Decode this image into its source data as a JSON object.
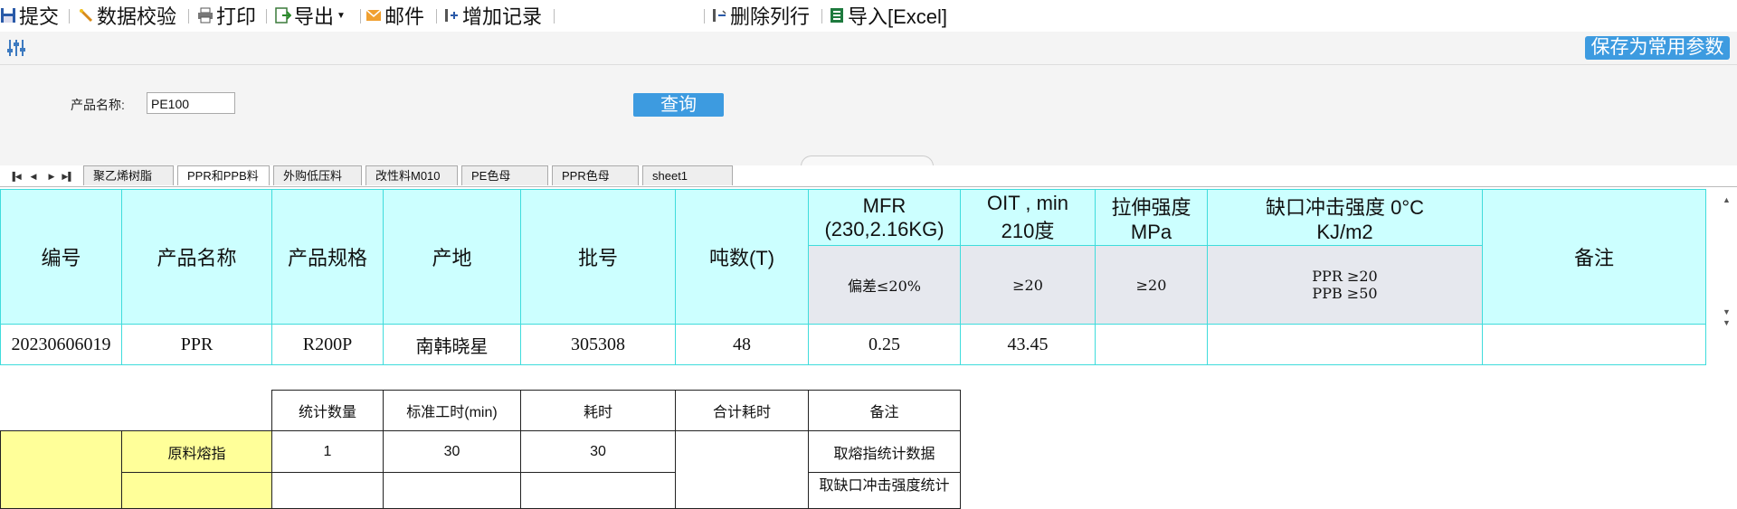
{
  "toolbar": {
    "submit": "提交",
    "validate": "数据校验",
    "print": "打印",
    "export": "导出",
    "mail": "邮件",
    "add_record": "增加记录",
    "delete_row": "删除列行",
    "import_excel": "导入[Excel]"
  },
  "params": {
    "save_btn": "保存为常用参数",
    "product_label": "产品名称:",
    "product_value": "PE100",
    "query_btn": "查询"
  },
  "tabs": [
    "聚乙烯树脂",
    "PPR和PPB料",
    "外购低压料",
    "改性料M010",
    "PE色母",
    "PPR色母",
    "sheet1"
  ],
  "main_table": {
    "headers": {
      "no": "编号",
      "product_name": "产品名称",
      "spec": "产品规格",
      "origin": "产地",
      "batch": "批号",
      "tonnage": "吨数(T)",
      "mfr_line1": "MFR",
      "mfr_line2": "(230,2.16KG)",
      "oit_line1": "OIT , min",
      "oit_line2": "210度",
      "tensile_line1": "拉伸强度",
      "tensile_line2": "MPa",
      "impact_line1": "缺口冲击强度 0°C",
      "impact_line2": "KJ/m2",
      "remark": "备注"
    },
    "sub_headers": {
      "mfr": "偏差≤20%",
      "oit": "≥20",
      "tensile": "≥20",
      "impact_line1": "PPR ≥20",
      "impact_line2": "PPB ≥50"
    },
    "row": {
      "no": "20230606019",
      "product_name": "PPR",
      "spec": "R200P",
      "origin": "南韩晓星",
      "batch": "305308",
      "tonnage": "48",
      "mfr": "0.25",
      "oit": "43.45",
      "tensile": "",
      "impact": "",
      "remark": ""
    }
  },
  "lower_table": {
    "headers": {
      "count": "统计数量",
      "std_time": "标准工时(min)",
      "time_cost": "耗时",
      "total_time": "合计耗时",
      "remark": "备注"
    },
    "row1": {
      "label": "原料熔指",
      "count": "1",
      "std_time": "30",
      "time_cost": "30",
      "remark": "取熔指统计数据"
    },
    "row2": {
      "remark": "取缺口冲击强度统计"
    }
  },
  "colors": {
    "cyan": "#ccffff",
    "yellow": "#ffff99",
    "accent": "#3d9be0"
  }
}
